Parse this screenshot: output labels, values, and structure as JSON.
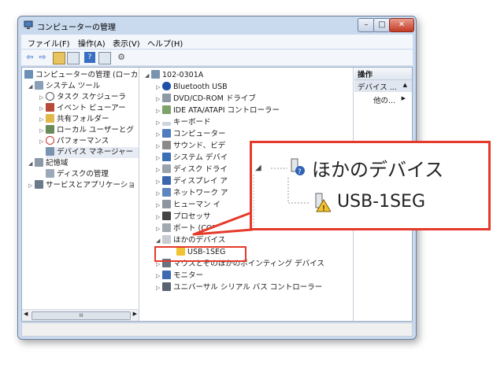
{
  "window": {
    "title": "コンピューターの管理"
  },
  "controls": {
    "minimize": "–",
    "maximize": "□",
    "close": "✕"
  },
  "menu": [
    "ファイル(F)",
    "操作(A)",
    "表示(V)",
    "ヘルプ(H)"
  ],
  "left_tree": [
    "コンピューターの管理 (ローカ",
    "システム ツール",
    "タスク スケジューラ",
    "イベント ビューアー",
    "共有フォルダー",
    "ローカル ユーザーとグ",
    "パフォーマンス",
    "デバイス マネージャー",
    "記憶域",
    "ディスクの管理",
    "サービスとアプリケーショ"
  ],
  "device_tree": {
    "root": "102-0301A",
    "items": [
      "Bluetooth USB",
      "DVD/CD-ROM ドライブ",
      "IDE ATA/ATAPI コントローラー",
      "キーボード",
      "コンピューター",
      "サウンド、ビデ",
      "システム デバイ",
      "ディスク ドライ",
      "ディスプレイ ア",
      "ネットワーク ア",
      "ヒューマン イ",
      "プロセッサ",
      "ポート (COM と",
      "ほかのデバイス",
      "USB-1SEG",
      "マウスとそのほかのポインティング デバイス",
      "モニター",
      "ユニバーサル シリアル バス コントローラー"
    ]
  },
  "actions": {
    "header": "操作",
    "item": "デバイス ...",
    "more": "他の..."
  },
  "scroll": {
    "left": "◀",
    "right": "▶",
    "grip": "III"
  },
  "callout": {
    "parent": "ほかのデバイス",
    "child": "USB-1SEG"
  },
  "colors": {
    "highlight": "#e53a2a",
    "frame": "#c9d9ee"
  }
}
